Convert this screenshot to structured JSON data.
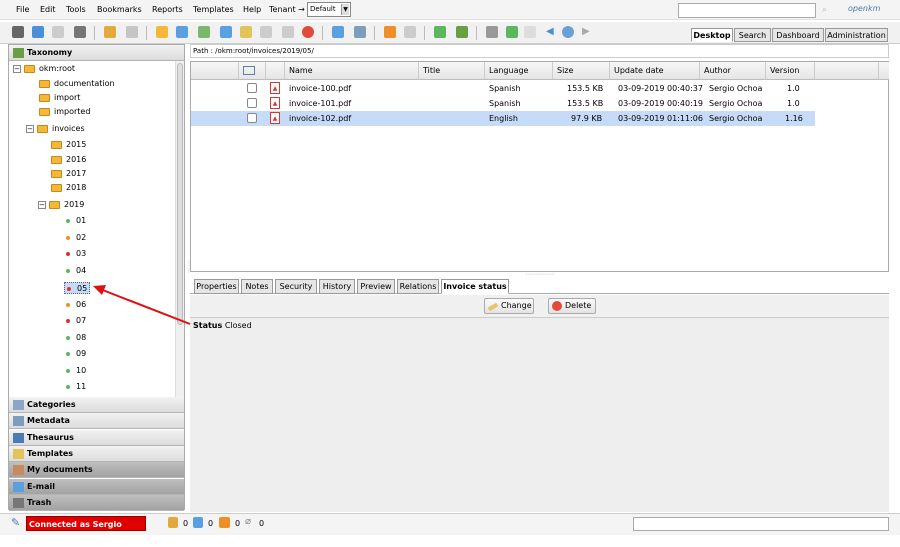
{
  "menu": {
    "items": [
      "File",
      "Edit",
      "Tools",
      "Bookmarks",
      "Reports",
      "Templates",
      "Help",
      "Tenant →"
    ],
    "tenant_value": "Default"
  },
  "logo": "openkm",
  "module_tabs": [
    "Desktop",
    "Search",
    "Dashboard",
    "Administration"
  ],
  "stack": {
    "taxonomy": "Taxonomy",
    "categories": "Categories",
    "metadata": "Metadata",
    "thesaurus": "Thesaurus",
    "templates": "Templates",
    "my_documents": "My documents",
    "email": "E-mail",
    "trash": "Trash"
  },
  "tree": {
    "root": "okm:root",
    "documentation": "documentation",
    "import": "import",
    "imported": "imported",
    "invoices": "invoices",
    "years": [
      "2015",
      "2016",
      "2017",
      "2018"
    ],
    "y2019": "2019",
    "months": [
      "01",
      "02",
      "03",
      "04",
      "05",
      "06",
      "07",
      "08",
      "09",
      "10",
      "11"
    ],
    "selected": "05"
  },
  "path": "Path : /okm:root/invoices/2019/05/",
  "columns": [
    "Name",
    "Title",
    "Language",
    "Size",
    "Update date",
    "Author",
    "Version"
  ],
  "rows": [
    {
      "name": "invoice-100.pdf",
      "title": "",
      "language": "Spanish",
      "size": "153.5 KB",
      "date": "03-09-2019 00:40:37",
      "author": "Sergio Ochoa",
      "version": "1.0"
    },
    {
      "name": "invoice-101.pdf",
      "title": "",
      "language": "Spanish",
      "size": "153.5 KB",
      "date": "03-09-2019 00:40:19",
      "author": "Sergio Ochoa",
      "version": "1.0"
    },
    {
      "name": "invoice-102.pdf",
      "title": "",
      "language": "English",
      "size": "97.9 KB",
      "date": "03-09-2019 01:11:06",
      "author": "Sergio Ochoa",
      "version": "1.16"
    }
  ],
  "bottom_tabs": [
    "Properties",
    "Notes",
    "Security",
    "History",
    "Preview",
    "Relations",
    "Invoice status"
  ],
  "buttons": {
    "change": "Change",
    "delete": "Delete"
  },
  "status": {
    "label": "Status",
    "value": "Closed"
  },
  "footer": {
    "connected": "Connected as Sergio Ochoa",
    "counts": [
      "0",
      "0",
      "0",
      "0"
    ]
  },
  "colors": {
    "accent": "#c6dbf7",
    "connected_bg": "#e10000",
    "folder": "#f5b73a"
  }
}
